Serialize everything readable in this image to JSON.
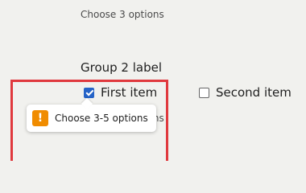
{
  "group1": {
    "hint": "Choose 3 options"
  },
  "group2": {
    "label": "Group 2 label",
    "options": [
      {
        "label": "First item",
        "checked": true
      },
      {
        "label": "Second item",
        "checked": false
      }
    ],
    "hint": "Choose 3 options"
  },
  "tooltip": {
    "icon": "warning-icon",
    "glyph": "!",
    "text": "Choose 3-5 options"
  },
  "colors": {
    "highlight": "#e0393e",
    "checkbox_checked": "#2563c7",
    "warning": "#f08c00"
  }
}
